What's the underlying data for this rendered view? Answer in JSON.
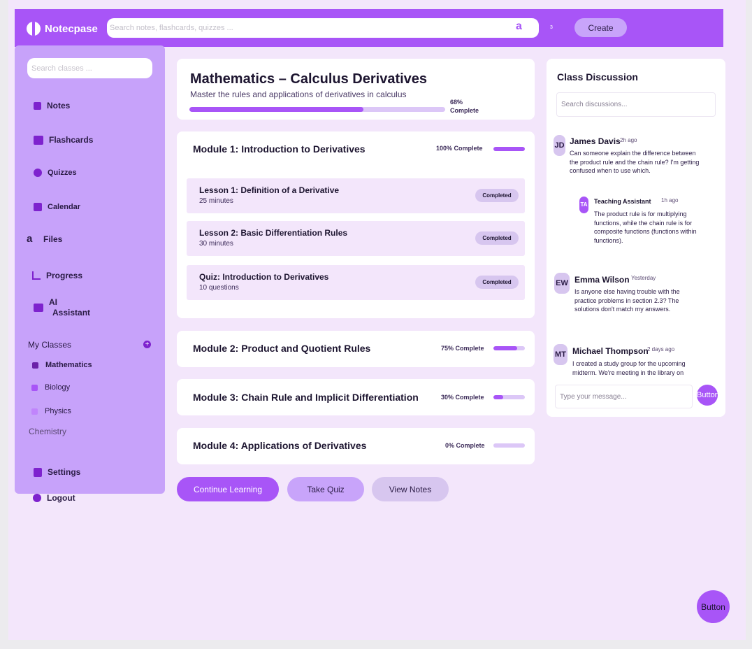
{
  "app": {
    "name": "Notecpase"
  },
  "header": {
    "search_placeholder": "Search notes, flashcards, quizzes ...",
    "search_glyph": "a",
    "notification_count": "3",
    "create_label": "Create"
  },
  "sidebar": {
    "search_placeholder": "Search classes ...",
    "nav": [
      {
        "label": "Notes",
        "icon": "note-icon"
      },
      {
        "label": "Flashcards",
        "icon": "flashcards-icon"
      },
      {
        "label": "Quizzes",
        "icon": "question-icon"
      },
      {
        "label": "Calendar",
        "icon": "calendar-icon"
      },
      {
        "label": "Files",
        "icon": "files-icon",
        "glyph": "a"
      },
      {
        "label": "Progress",
        "icon": "chart-icon"
      },
      {
        "label": "AI",
        "label2": "Assistant",
        "icon": "robot-icon"
      }
    ],
    "my_classes_label": "My Classes",
    "classes": [
      {
        "label": "Mathematics",
        "color": "#6b21a8"
      },
      {
        "label": "Biology",
        "color": "#a855f7"
      },
      {
        "label": "Physics",
        "color": "#c084fc"
      },
      {
        "label": "Chemistry"
      }
    ],
    "settings_label": "Settings",
    "logout_label": "Logout"
  },
  "course": {
    "title": "Mathematics – Calculus Derivatives",
    "subtitle": "Master the rules and applications of derivatives in calculus",
    "progress": 68,
    "progress_label": "68% Complete"
  },
  "modules": [
    {
      "title": "Module 1: Introduction to Derivatives",
      "progress": 100,
      "progress_label": "100% Complete",
      "lessons": [
        {
          "title": "Lesson 1: Definition of a Derivative",
          "meta": "25 minutes",
          "status": "Completed"
        },
        {
          "title": "Lesson 2: Basic Differentiation Rules",
          "meta": "30 minutes",
          "status": "Completed"
        },
        {
          "title": "Quiz: Introduction to Derivatives",
          "meta": "10 questions",
          "status": "Completed"
        }
      ]
    },
    {
      "title": "Module 2: Product and Quotient Rules",
      "progress": 75,
      "progress_label": "75% Complete"
    },
    {
      "title": "Module 3: Chain Rule and Implicit Differentiation",
      "progress": 30,
      "progress_label": "30% Complete"
    },
    {
      "title": "Module 4: Applications of Derivatives",
      "progress": 0,
      "progress_label": "0% Complete"
    }
  ],
  "actions": {
    "continue": "Continue Learning",
    "quiz": "Take Quiz",
    "notes": "View Notes"
  },
  "discussion": {
    "title": "Class Discussion",
    "search_placeholder": "Search discussions...",
    "posts": [
      {
        "initials": "JD",
        "name": "James Davis",
        "time": "2h ago",
        "text": "Can someone explain the difference between the product rule and the chain rule? I'm getting confused when to use which."
      },
      {
        "initials": "TA",
        "name": "Teaching Assistant",
        "time": "1h ago",
        "text": "The product rule is for multiplying functions, while the chain rule is for composite functions (functions within functions)."
      },
      {
        "initials": "EW",
        "name": "Emma Wilson",
        "time": "Yesterday",
        "text": "Is anyone else having trouble with the practice problems in section 2.3? The solutions don't match my answers."
      },
      {
        "initials": "MT",
        "name": "Michael Thompson",
        "time": "2 days ago",
        "text": "I created a study group for the upcoming midterm. We're meeting in the library on"
      }
    ],
    "message_placeholder": "Type your message...",
    "send_label": "Button"
  },
  "fab_label": "Button",
  "colors": {
    "accent": "#a855f7",
    "sidebar": "#c7a2fa",
    "background": "#f3e6fb"
  }
}
